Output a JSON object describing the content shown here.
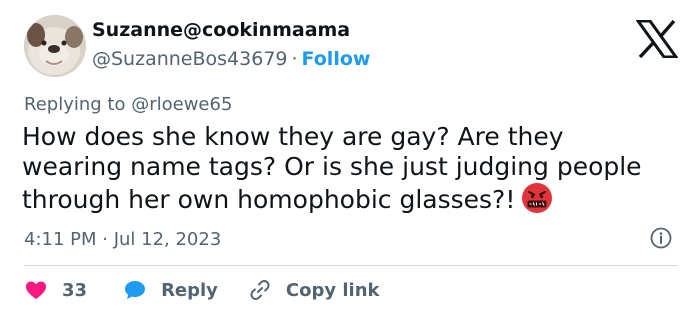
{
  "author": {
    "display_name": "Suzanne@cookinmaama",
    "handle": "@SuzanneBos43679",
    "separator": "·",
    "follow_label": "Follow",
    "avatar_icon": "bulldog-avatar"
  },
  "platform_icon": "x-logo-icon",
  "reply_context": {
    "prefix": "Replying to",
    "mention": "@rloewe65"
  },
  "tweet": {
    "text": "How does she know they are gay? Are they\nwearing name tags?  Or is she just judging people\nthrough her own homophobic glasses?!",
    "emoji": "face-with-symbols-on-mouth",
    "timestamp": "4:11 PM · Jul 12, 2023"
  },
  "actions": {
    "like_count": "33",
    "reply_label": "Reply",
    "copy_link_label": "Copy link"
  },
  "colors": {
    "accent": "#1d9bf0",
    "like": "#f91880",
    "secondary_text": "#536471",
    "emoji_red": "#e0343a"
  }
}
